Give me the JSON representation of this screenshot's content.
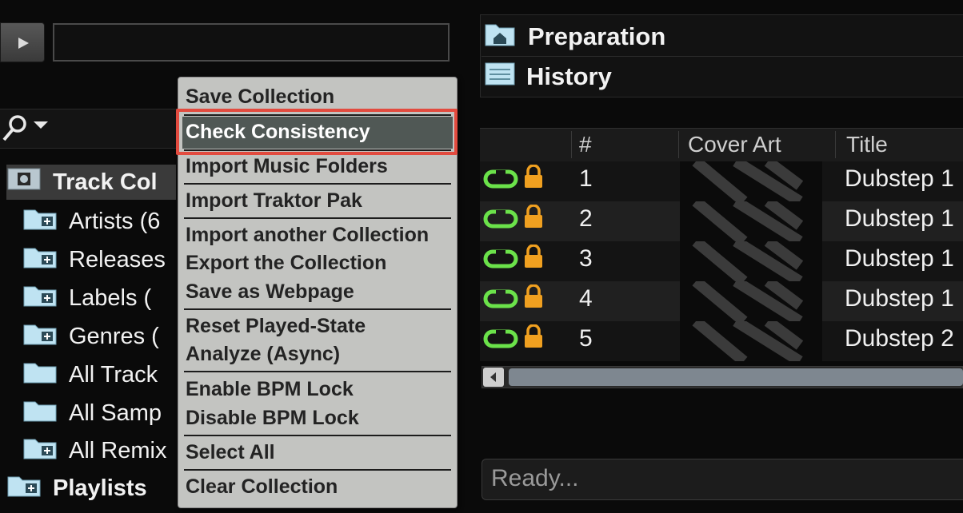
{
  "preview": {
    "field_value": ""
  },
  "search": {
    "value": ""
  },
  "tree": {
    "root": "Track Col",
    "items": [
      {
        "label": "Artists (6",
        "icon": "folder-plus-icon"
      },
      {
        "label": "Releases",
        "icon": "folder-plus-icon"
      },
      {
        "label": "Labels (",
        "icon": "folder-plus-icon"
      },
      {
        "label": "Genres (",
        "icon": "folder-plus-icon"
      },
      {
        "label": "All Track",
        "icon": "folder-icon"
      },
      {
        "label": "All Samp",
        "icon": "folder-icon"
      },
      {
        "label": "All Remix",
        "icon": "folder-plus-icon"
      }
    ],
    "playlists": "Playlists"
  },
  "favorites": {
    "preparation": "Preparation",
    "history": "History"
  },
  "columns": {
    "num": "#",
    "cover": "Cover Art",
    "title": "Title"
  },
  "tracks": [
    {
      "num": "1",
      "title": "Dubstep 1"
    },
    {
      "num": "2",
      "title": "Dubstep 1"
    },
    {
      "num": "3",
      "title": "Dubstep 1"
    },
    {
      "num": "4",
      "title": "Dubstep 1"
    },
    {
      "num": "5",
      "title": "Dubstep 2"
    }
  ],
  "status": {
    "text": "Ready..."
  },
  "menu": {
    "save_collection": "Save Collection",
    "check_consistency": "Check Consistency",
    "import_music_folders": "Import Music Folders",
    "import_traktor_pak": "Import Traktor Pak",
    "import_another": "Import another Collection",
    "export_collection": "Export the Collection",
    "save_webpage": "Save as Webpage",
    "reset_played": "Reset Played-State",
    "analyze_async": "Analyze (Async)",
    "enable_bpm_lock": "Enable BPM Lock",
    "disable_bpm_lock": "Disable BPM Lock",
    "select_all": "Select All",
    "clear_collection": "Clear Collection"
  },
  "colors": {
    "accent_highlight": "#e24b3f",
    "link_green": "#6be24a",
    "lock_orange": "#f0a020",
    "folder_blue": "#bfe3f2"
  }
}
